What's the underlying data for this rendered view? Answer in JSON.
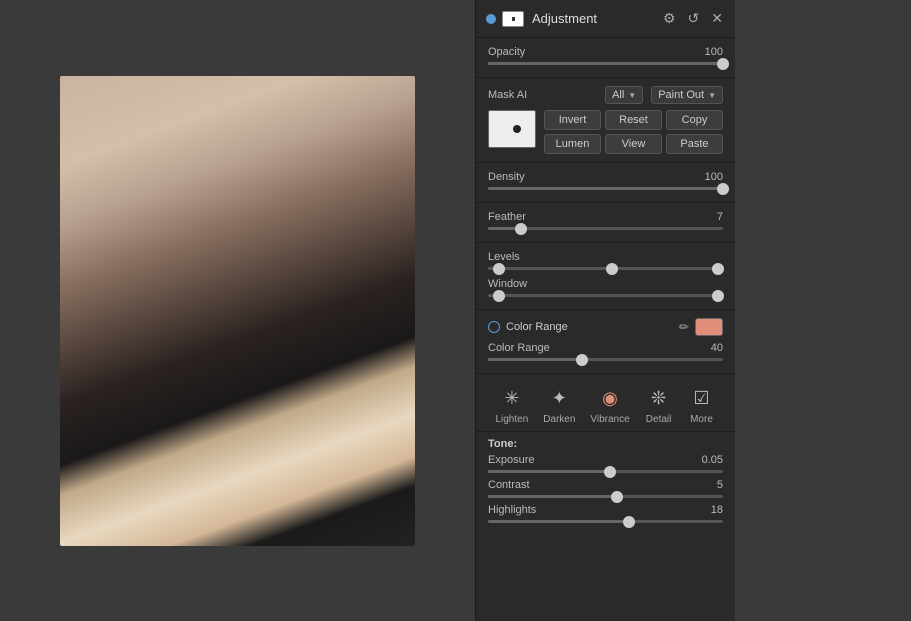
{
  "panel": {
    "title": "Adjustment",
    "header": {
      "settings_icon": "⚙",
      "undo_icon": "↺",
      "close_icon": "✕"
    },
    "opacity": {
      "label": "Opacity",
      "value": "100",
      "slider_pct": 100
    },
    "mask_ai": {
      "label": "Mask AI",
      "dropdown_all": "All",
      "dropdown_paint_out": "Paint Out",
      "buttons": {
        "invert": "Invert",
        "reset": "Reset",
        "copy": "Copy",
        "lumen": "Lumen",
        "view": "View",
        "paste": "Paste"
      }
    },
    "density": {
      "label": "Density",
      "value": "100",
      "slider_pct": 100
    },
    "feather": {
      "label": "Feather",
      "value": "7",
      "slider_pct": 14
    },
    "levels": {
      "label": "Levels",
      "left_pct": 2,
      "mid_pct": 50,
      "right_pct": 98
    },
    "window": {
      "label": "Window",
      "left_pct": 2,
      "right_pct": 98
    },
    "color_range": {
      "label": "Color Range",
      "value": "40",
      "slider_pct": 40,
      "swatch_color": "#e0907a"
    },
    "tabs": [
      {
        "id": "lighten",
        "label": "Lighten",
        "icon": "✳",
        "active": false
      },
      {
        "id": "darken",
        "label": "Darken",
        "icon": "✦",
        "active": false
      },
      {
        "id": "vibrance",
        "label": "Vibrance",
        "icon": "◎",
        "active": false
      },
      {
        "id": "detail",
        "label": "Detail",
        "icon": "❋",
        "active": false
      },
      {
        "id": "more",
        "label": "More",
        "icon": "☑",
        "active": false
      }
    ],
    "tone": {
      "title": "Tone:",
      "exposure": {
        "label": "Exposure",
        "value": "0.05",
        "slider_pct": 52
      },
      "contrast": {
        "label": "Contrast",
        "value": "5",
        "slider_pct": 55
      },
      "highlights": {
        "label": "Highlights",
        "value": "18",
        "slider_pct": 60
      }
    }
  }
}
